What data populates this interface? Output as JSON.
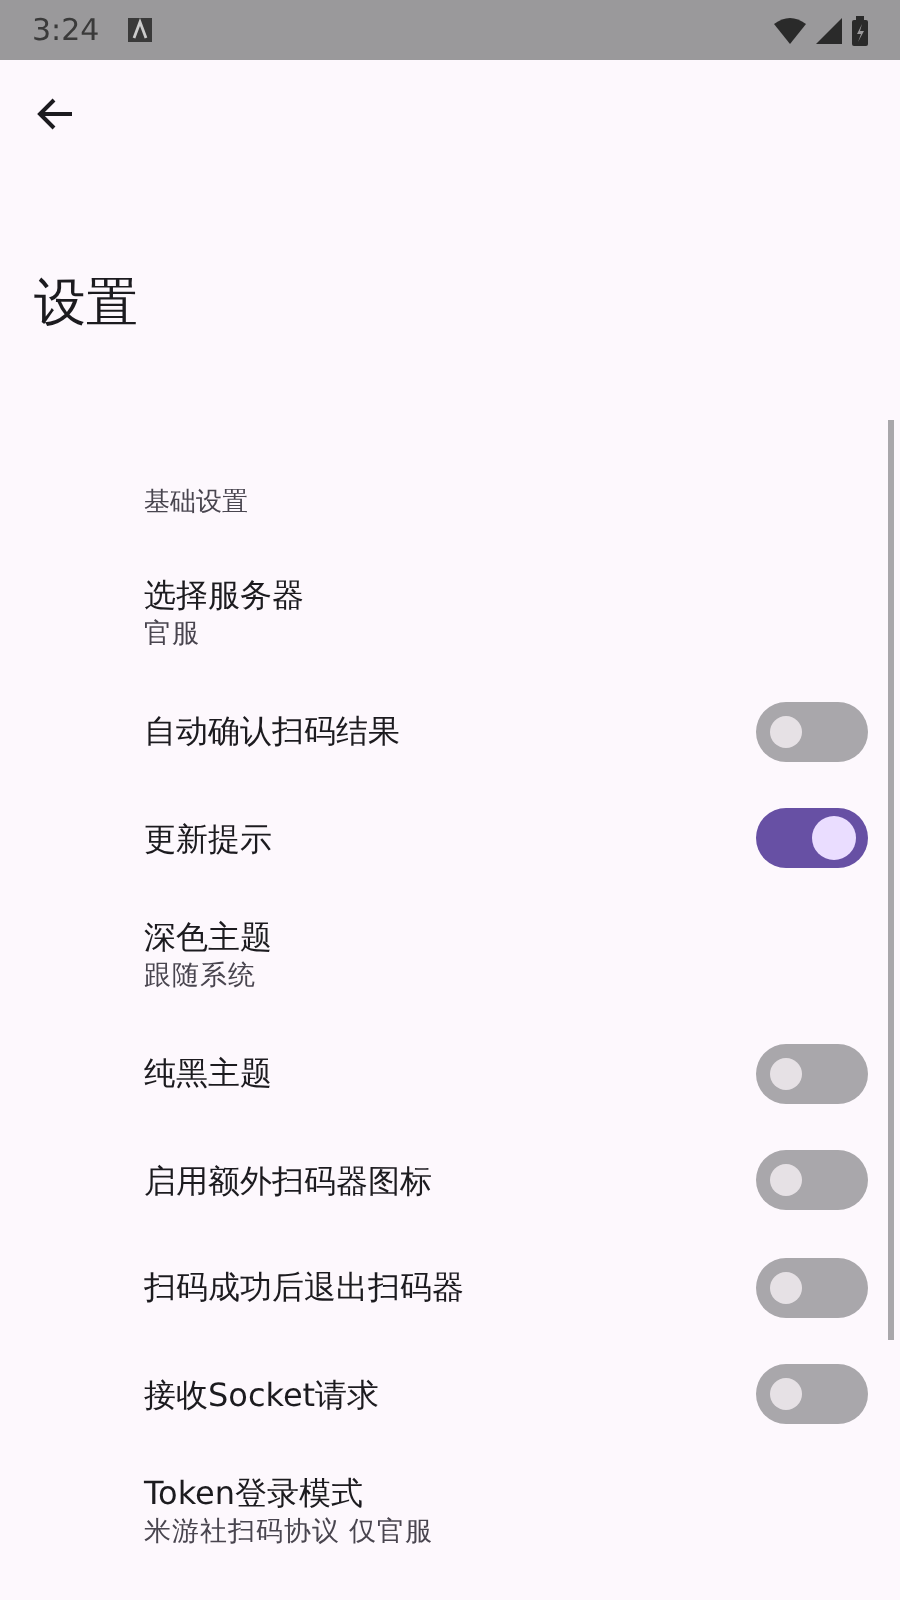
{
  "status_bar": {
    "time": "3:24"
  },
  "title": "设置",
  "category": "基础设置",
  "settings": [
    {
      "kind": "link",
      "title": "选择服务器",
      "summary": "官服"
    },
    {
      "kind": "switch",
      "title": "自动确认扫码结果",
      "on": false
    },
    {
      "kind": "switch",
      "title": "更新提示",
      "on": true
    },
    {
      "kind": "link",
      "title": "深色主题",
      "summary": "跟随系统"
    },
    {
      "kind": "switch",
      "title": "纯黑主题",
      "on": false
    },
    {
      "kind": "switch",
      "title": "启用额外扫码器图标",
      "on": false
    },
    {
      "kind": "switch",
      "title": "扫码成功后退出扫码器",
      "on": false
    },
    {
      "kind": "switch",
      "title": "接收Socket请求",
      "on": false
    },
    {
      "kind": "link",
      "title": "Token登录模式",
      "summary": "米游社扫码协议 仅官服"
    }
  ]
}
